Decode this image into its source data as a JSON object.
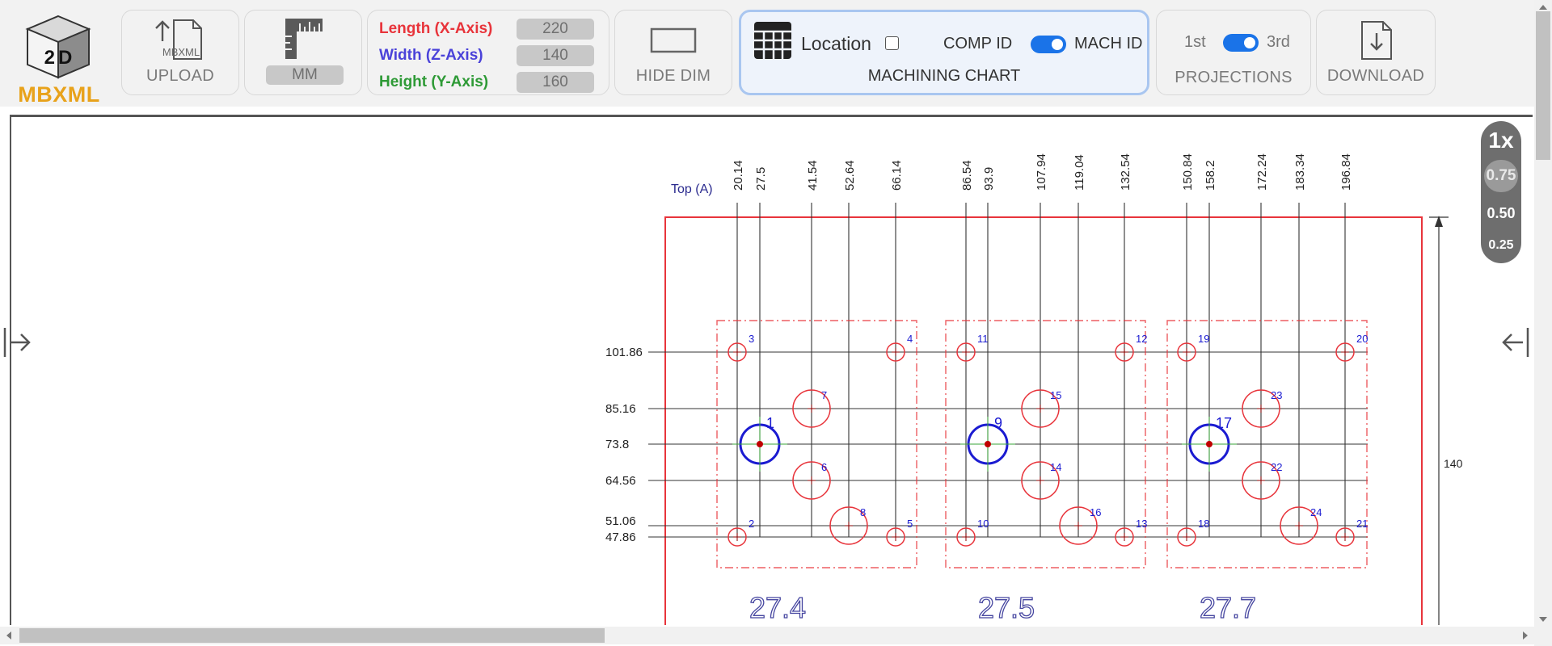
{
  "app": {
    "logo_badge": "2D",
    "logo_text": "MBXML"
  },
  "toolbar": {
    "upload": {
      "label": "UPLOAD",
      "icon_text": "MBXML"
    },
    "units": {
      "value": "MM"
    },
    "dimensions": {
      "length_label": "Length (X-Axis)",
      "length_value": "220",
      "width_label": "Width (Z-Axis)",
      "width_value": "140",
      "height_label": "Height (Y-Axis)",
      "height_value": "160"
    },
    "hide_dim": {
      "label": "HIDE DIM"
    },
    "machining_chart": {
      "location_label": "Location",
      "location_checked": false,
      "comp_id_label": "COMP ID",
      "mach_id_label": "MACH ID",
      "title": "MACHINING CHART"
    },
    "projections": {
      "first_label": "1st",
      "third_label": "3rd",
      "title": "PROJECTIONS"
    },
    "download": {
      "label": "DOWNLOAD"
    }
  },
  "zoom": {
    "levels": [
      "1x",
      "0.75",
      "0.50",
      "0.25"
    ],
    "active": "1x"
  },
  "drawing": {
    "view_label": "Top (A)",
    "x_dims": [
      "20.14",
      "27.5",
      "41.54",
      "52.64",
      "66.14",
      "86.54",
      "93.9",
      "107.94",
      "119.04",
      "132.54",
      "150.84",
      "158.2",
      "172.24",
      "183.34",
      "196.84"
    ],
    "y_dims": [
      "101.86",
      "85.16",
      "73.8",
      "64.56",
      "51.06",
      "47.86"
    ],
    "right_dim": "140",
    "part_labels": [
      "27.4",
      "27.5",
      "27.7"
    ],
    "hole_ids": [
      "1",
      "2",
      "3",
      "4",
      "5",
      "6",
      "7",
      "8",
      "9",
      "10",
      "11",
      "12",
      "13",
      "14",
      "15",
      "16",
      "17",
      "18",
      "19",
      "20",
      "21",
      "22",
      "23",
      "24"
    ]
  },
  "colors": {
    "length": "#e8343b",
    "width": "#4a42d9",
    "height": "#2e9a36",
    "accent_blue": "#1a73e8",
    "logo_orange": "#e8a21b",
    "drawing_red": "#e8343b",
    "drawing_blue": "#1b1bd1"
  }
}
